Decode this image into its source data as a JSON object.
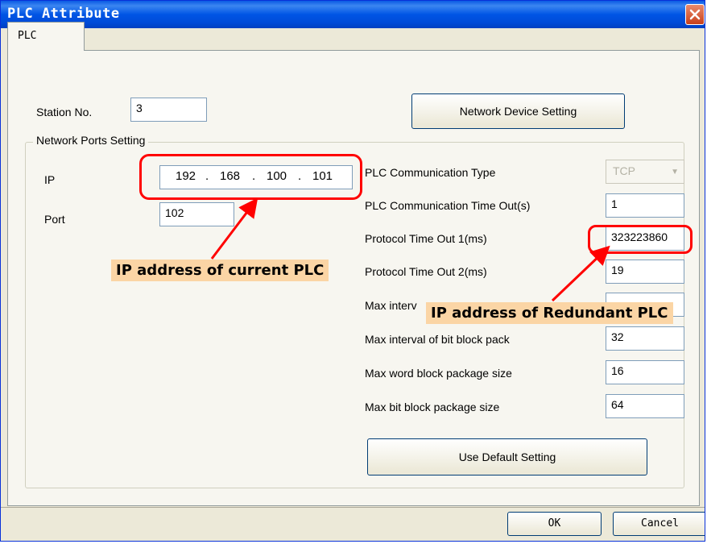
{
  "window": {
    "title": "PLC Attribute"
  },
  "tabs": [
    {
      "label": "PLC"
    }
  ],
  "station": {
    "label": "Station No.",
    "value": "3"
  },
  "network_device_button": "Network Device Setting",
  "network_ports": {
    "legend": "Network Ports Setting",
    "ip_label": "IP",
    "ip_octets": [
      "192",
      "168",
      "100",
      "101"
    ],
    "port_label": "Port",
    "port_value": "102"
  },
  "params": {
    "comm_type_label": "PLC Communication Type",
    "comm_type_value": "TCP",
    "timeout_label": "PLC Communication Time Out(s)",
    "timeout_value": "1",
    "proto1_label": "Protocol Time Out 1(ms)",
    "proto1_value": "323223860",
    "proto2_label": "Protocol Time Out 2(ms)",
    "proto2_value": "19",
    "max_word_interval_label": "Max interv",
    "max_bit_interval_label": "Max interval of bit block pack",
    "max_bit_interval_value": "32",
    "max_word_size_label": "Max word block package size",
    "max_word_size_value": "16",
    "max_bit_size_label": "Max bit block package size",
    "max_bit_size_value": "64"
  },
  "default_button": "Use Default Setting",
  "ok_button": "OK",
  "cancel_button": "Cancel",
  "annotations": {
    "current_plc": "IP address of current PLC",
    "redundant_plc": "IP address of Redundant PLC"
  },
  "colors": {
    "titlebar": "#0055e5",
    "annotation_red": "#ff0000",
    "callout_bg": "#fbd5a5"
  },
  "icons": {
    "close": "close-icon",
    "dropdown": "chevron-down-icon"
  }
}
